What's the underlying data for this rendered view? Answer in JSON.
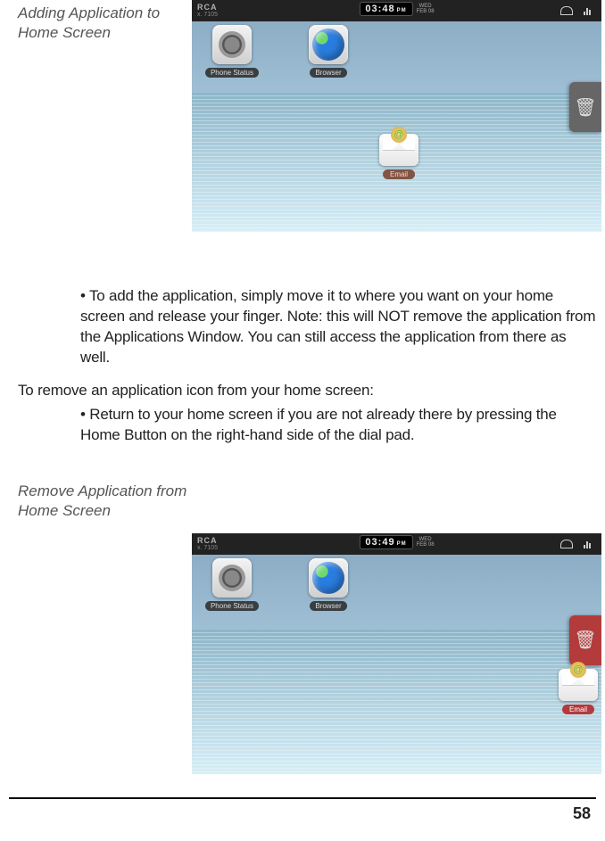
{
  "captions": {
    "add": "Adding Application to Home Screen",
    "remove": "Remove Application from Home Screen"
  },
  "text": {
    "bullet_add": "• To add the application, simply move it to where you want on your home screen and release your finger. Note: this will NOT remove the application from the Applications Window. You can still access the application from there as well.",
    "remove_intro": "To remove an application icon from your home screen:",
    "bullet_remove": "• Return to your home screen if you are not already there by pressing the Home Button on the right-hand side of the dial pad."
  },
  "screenshot": {
    "brand": "RCA",
    "model": "x. 7105",
    "time1": "03:48",
    "time2": "03:49",
    "ampm": "PM",
    "day": "WED",
    "date": "FEB 08",
    "app1": "Phone Status",
    "app2": "Browser",
    "drag_label": "Email",
    "trash_glyph": "🗑",
    "at": "@"
  },
  "page_number": "58"
}
